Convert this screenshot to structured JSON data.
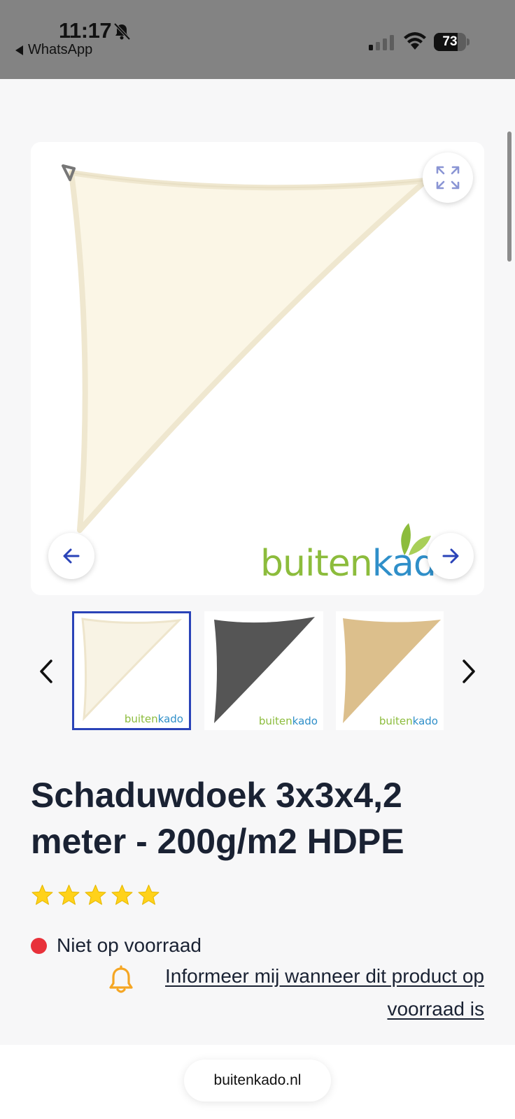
{
  "status_bar": {
    "time": "11:17",
    "back_app": "WhatsApp",
    "battery": "73",
    "battery_level": 0.73
  },
  "gallery": {
    "brand_logo_green": "buiten",
    "brand_logo_blue": "kado",
    "icons": {
      "expand": "expand-icon",
      "prev": "arrow-left-icon",
      "next": "arrow-right-icon"
    },
    "thumbnails": [
      {
        "color": "#f8f3e4",
        "selected": true
      },
      {
        "color": "#555555",
        "selected": false
      },
      {
        "color": "#dcbf8c",
        "selected": false
      }
    ]
  },
  "product": {
    "title": "Schaduwdoek 3x3x4,2 meter - 200g/m2 HDPE",
    "rating": 5,
    "stock_status": "Niet op voorraad",
    "notify_link": "Informeer mij wanneer dit product op voorraad is"
  },
  "browser": {
    "url": "buitenkado.nl"
  },
  "colors": {
    "accent": "#2a43b8",
    "out_of_stock": "#e8313a",
    "star": "#ffd21a",
    "bell": "#f5a623"
  }
}
